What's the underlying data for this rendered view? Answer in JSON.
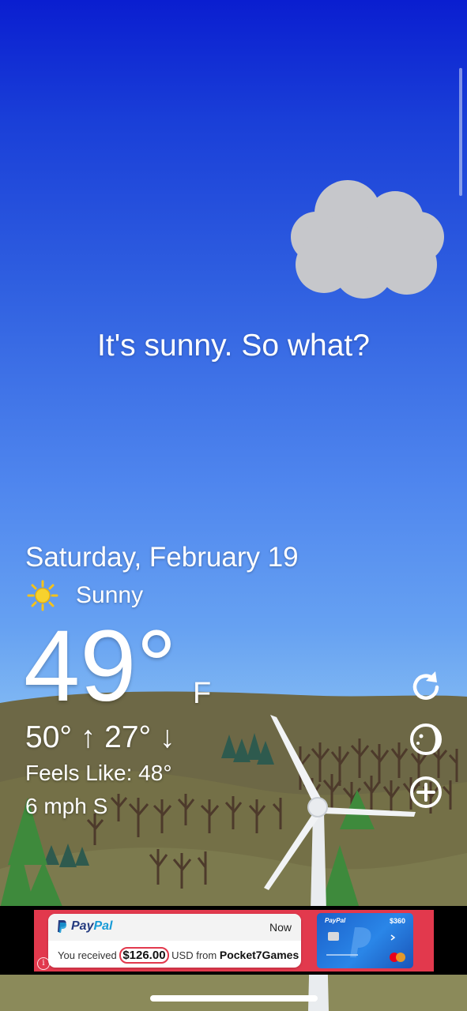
{
  "tagline": "It's sunny. So what?",
  "date": "Saturday, February 19",
  "condition": {
    "icon": "sun-icon",
    "text": "Sunny"
  },
  "temperature": {
    "value": "49°",
    "unit": "F"
  },
  "high_low": "50° ↑ 27° ↓",
  "feels_like": "Feels Like: 48°",
  "wind": "6 mph S",
  "side_buttons": [
    {
      "name": "refresh-icon"
    },
    {
      "name": "moon-phase-icon"
    },
    {
      "name": "add-location-icon"
    }
  ],
  "ad": {
    "brand_prefix": "Pay",
    "brand_suffix": "Pal",
    "time": "Now",
    "body_prefix": "You received",
    "amount": "$126.00",
    "body_middle": "USD from",
    "sender": "Pocket7Games",
    "card_brand": "PayPal",
    "card_amount": "$360",
    "info_icon": "i"
  },
  "colors": {
    "sky_top": "#0a1ed0",
    "sky_bottom": "#8ec2f2",
    "hill_back": "#6d6846",
    "hill_front": "#7c7a4e",
    "tree_green": "#3e8a3c",
    "ad_red": "#e2394d",
    "paypal_blue": "#253b80"
  }
}
